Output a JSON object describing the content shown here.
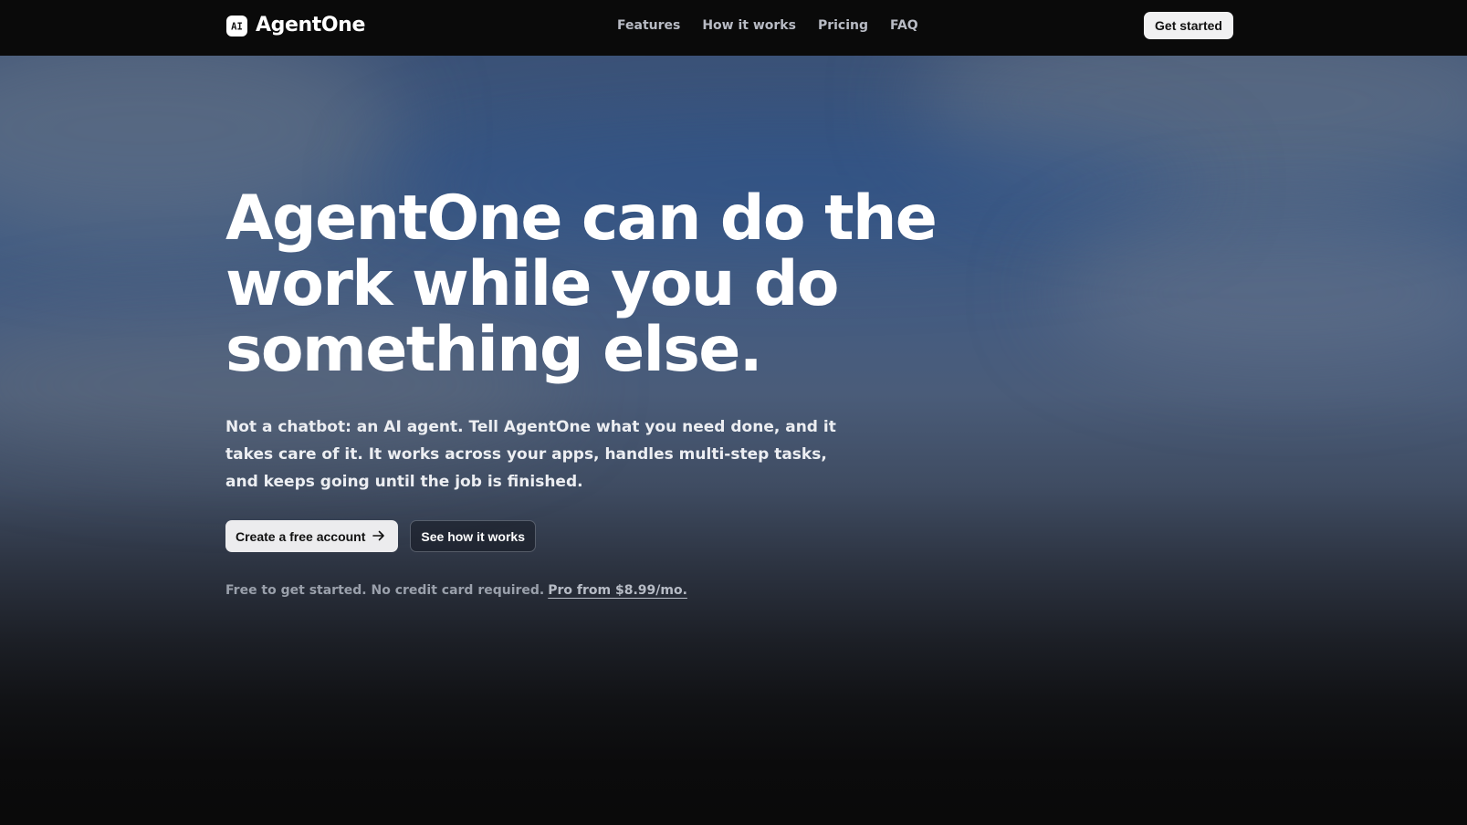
{
  "nav": {
    "brand_name": "AgentOne",
    "logo_text": "AI",
    "links": [
      {
        "label": "Features"
      },
      {
        "label": "How it works"
      },
      {
        "label": "Pricing"
      },
      {
        "label": "FAQ"
      }
    ],
    "cta_label": "Get started"
  },
  "hero": {
    "title": "AgentOne can do the work while you do something else.",
    "subtitle": "Not a chatbot: an AI agent. Tell AgentOne what you need done, and it takes care of it. It works across your apps, handles multi-step tasks, and keeps going until the job is finished.",
    "primary_cta": "Create a free account",
    "primary_cta_icon": "arrow-right-icon",
    "secondary_cta": "See how it works",
    "fineprint": "Free to get started. No credit card required.",
    "fineprint_link": "Pro from $8.99/mo."
  },
  "colors": {
    "nav_background": "#0a0a0a",
    "hero_top": "#3a5680",
    "hero_bottom": "#0a0a0a",
    "button_light": "#ececee",
    "muted_text": "#9aa0ab"
  }
}
